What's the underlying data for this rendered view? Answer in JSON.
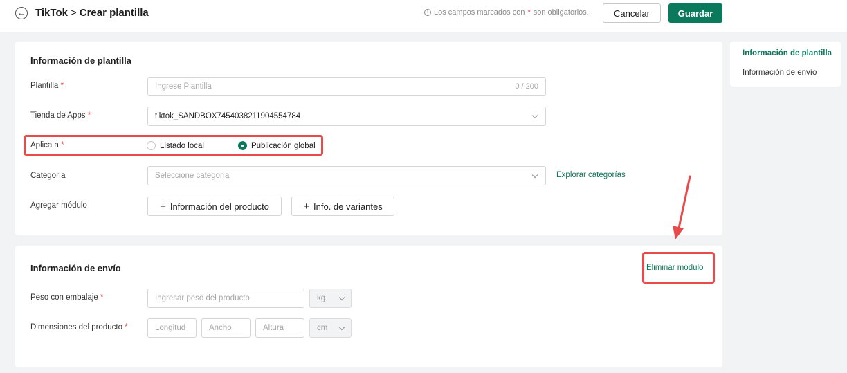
{
  "header": {
    "back_icon": "arrow-left-icon",
    "breadcrumb_root": "TikTok",
    "breadcrumb_sep": ">",
    "breadcrumb_current": "Crear plantilla",
    "required_note_prefix": "Los campos marcados con",
    "required_note_star": "*",
    "required_note_suffix": "son obligatorios.",
    "cancel_label": "Cancelar",
    "save_label": "Guardar"
  },
  "template_section": {
    "title": "Información de plantilla",
    "template_label": "Plantilla",
    "template_placeholder": "Ingrese Plantilla",
    "template_counter": "0 / 200",
    "store_label": "Tienda de Apps",
    "store_value": "tiktok_SANDBOX7454038211904554784",
    "applies_label": "Aplica a",
    "applies_options": [
      "Listado local",
      "Publicación global"
    ],
    "applies_selected": "Publicación global",
    "category_label": "Categoría",
    "category_placeholder": "Seleccione categoría",
    "explore_link": "Explorar categorías",
    "add_module_label": "Agregar módulo",
    "module_buttons": [
      "Información del producto",
      "Info. de variantes"
    ]
  },
  "shipping_section": {
    "title": "Información de envío",
    "remove_link": "Eliminar módulo",
    "weight_label": "Peso con embalaje",
    "weight_placeholder": "Ingresar peso del producto",
    "weight_unit": "kg",
    "dims_label": "Dimensiones del producto",
    "length_placeholder": "Longitud",
    "width_placeholder": "Ancho",
    "height_placeholder": "Altura",
    "dims_unit": "cm"
  },
  "sidebar": {
    "items": [
      "Información de plantilla",
      "Información de envío"
    ],
    "active": "Información de plantilla"
  },
  "colors": {
    "primary": "#0b7a5c",
    "required_star": "#e0393e",
    "highlight": "#e94a4a"
  }
}
